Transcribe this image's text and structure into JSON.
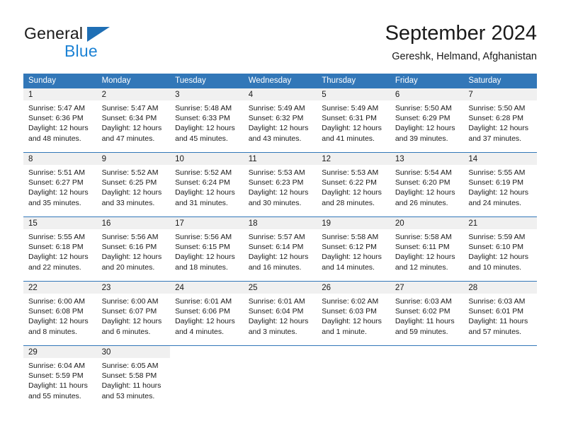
{
  "brand": {
    "name_part1": "General",
    "name_part2": "Blue",
    "triangle_color": "#1f6fb5",
    "blue_color": "#1c82d4"
  },
  "header": {
    "title": "September 2024",
    "location": "Gereshk, Helmand, Afghanistan"
  },
  "theme": {
    "header_row_bg": "#3277b8",
    "daynum_band_bg": "#f0f0f0",
    "grid_line": "#3277b8",
    "text": "#1a1a1a"
  },
  "weekday_headers": [
    "Sunday",
    "Monday",
    "Tuesday",
    "Wednesday",
    "Thursday",
    "Friday",
    "Saturday"
  ],
  "weeks": [
    [
      {
        "day": "1",
        "sunrise": "Sunrise: 5:47 AM",
        "sunset": "Sunset: 6:36 PM",
        "daylight": "Daylight: 12 hours and 48 minutes."
      },
      {
        "day": "2",
        "sunrise": "Sunrise: 5:47 AM",
        "sunset": "Sunset: 6:34 PM",
        "daylight": "Daylight: 12 hours and 47 minutes."
      },
      {
        "day": "3",
        "sunrise": "Sunrise: 5:48 AM",
        "sunset": "Sunset: 6:33 PM",
        "daylight": "Daylight: 12 hours and 45 minutes."
      },
      {
        "day": "4",
        "sunrise": "Sunrise: 5:49 AM",
        "sunset": "Sunset: 6:32 PM",
        "daylight": "Daylight: 12 hours and 43 minutes."
      },
      {
        "day": "5",
        "sunrise": "Sunrise: 5:49 AM",
        "sunset": "Sunset: 6:31 PM",
        "daylight": "Daylight: 12 hours and 41 minutes."
      },
      {
        "day": "6",
        "sunrise": "Sunrise: 5:50 AM",
        "sunset": "Sunset: 6:29 PM",
        "daylight": "Daylight: 12 hours and 39 minutes."
      },
      {
        "day": "7",
        "sunrise": "Sunrise: 5:50 AM",
        "sunset": "Sunset: 6:28 PM",
        "daylight": "Daylight: 12 hours and 37 minutes."
      }
    ],
    [
      {
        "day": "8",
        "sunrise": "Sunrise: 5:51 AM",
        "sunset": "Sunset: 6:27 PM",
        "daylight": "Daylight: 12 hours and 35 minutes."
      },
      {
        "day": "9",
        "sunrise": "Sunrise: 5:52 AM",
        "sunset": "Sunset: 6:25 PM",
        "daylight": "Daylight: 12 hours and 33 minutes."
      },
      {
        "day": "10",
        "sunrise": "Sunrise: 5:52 AM",
        "sunset": "Sunset: 6:24 PM",
        "daylight": "Daylight: 12 hours and 31 minutes."
      },
      {
        "day": "11",
        "sunrise": "Sunrise: 5:53 AM",
        "sunset": "Sunset: 6:23 PM",
        "daylight": "Daylight: 12 hours and 30 minutes."
      },
      {
        "day": "12",
        "sunrise": "Sunrise: 5:53 AM",
        "sunset": "Sunset: 6:22 PM",
        "daylight": "Daylight: 12 hours and 28 minutes."
      },
      {
        "day": "13",
        "sunrise": "Sunrise: 5:54 AM",
        "sunset": "Sunset: 6:20 PM",
        "daylight": "Daylight: 12 hours and 26 minutes."
      },
      {
        "day": "14",
        "sunrise": "Sunrise: 5:55 AM",
        "sunset": "Sunset: 6:19 PM",
        "daylight": "Daylight: 12 hours and 24 minutes."
      }
    ],
    [
      {
        "day": "15",
        "sunrise": "Sunrise: 5:55 AM",
        "sunset": "Sunset: 6:18 PM",
        "daylight": "Daylight: 12 hours and 22 minutes."
      },
      {
        "day": "16",
        "sunrise": "Sunrise: 5:56 AM",
        "sunset": "Sunset: 6:16 PM",
        "daylight": "Daylight: 12 hours and 20 minutes."
      },
      {
        "day": "17",
        "sunrise": "Sunrise: 5:56 AM",
        "sunset": "Sunset: 6:15 PM",
        "daylight": "Daylight: 12 hours and 18 minutes."
      },
      {
        "day": "18",
        "sunrise": "Sunrise: 5:57 AM",
        "sunset": "Sunset: 6:14 PM",
        "daylight": "Daylight: 12 hours and 16 minutes."
      },
      {
        "day": "19",
        "sunrise": "Sunrise: 5:58 AM",
        "sunset": "Sunset: 6:12 PM",
        "daylight": "Daylight: 12 hours and 14 minutes."
      },
      {
        "day": "20",
        "sunrise": "Sunrise: 5:58 AM",
        "sunset": "Sunset: 6:11 PM",
        "daylight": "Daylight: 12 hours and 12 minutes."
      },
      {
        "day": "21",
        "sunrise": "Sunrise: 5:59 AM",
        "sunset": "Sunset: 6:10 PM",
        "daylight": "Daylight: 12 hours and 10 minutes."
      }
    ],
    [
      {
        "day": "22",
        "sunrise": "Sunrise: 6:00 AM",
        "sunset": "Sunset: 6:08 PM",
        "daylight": "Daylight: 12 hours and 8 minutes."
      },
      {
        "day": "23",
        "sunrise": "Sunrise: 6:00 AM",
        "sunset": "Sunset: 6:07 PM",
        "daylight": "Daylight: 12 hours and 6 minutes."
      },
      {
        "day": "24",
        "sunrise": "Sunrise: 6:01 AM",
        "sunset": "Sunset: 6:06 PM",
        "daylight": "Daylight: 12 hours and 4 minutes."
      },
      {
        "day": "25",
        "sunrise": "Sunrise: 6:01 AM",
        "sunset": "Sunset: 6:04 PM",
        "daylight": "Daylight: 12 hours and 3 minutes."
      },
      {
        "day": "26",
        "sunrise": "Sunrise: 6:02 AM",
        "sunset": "Sunset: 6:03 PM",
        "daylight": "Daylight: 12 hours and 1 minute."
      },
      {
        "day": "27",
        "sunrise": "Sunrise: 6:03 AM",
        "sunset": "Sunset: 6:02 PM",
        "daylight": "Daylight: 11 hours and 59 minutes."
      },
      {
        "day": "28",
        "sunrise": "Sunrise: 6:03 AM",
        "sunset": "Sunset: 6:01 PM",
        "daylight": "Daylight: 11 hours and 57 minutes."
      }
    ],
    [
      {
        "day": "29",
        "sunrise": "Sunrise: 6:04 AM",
        "sunset": "Sunset: 5:59 PM",
        "daylight": "Daylight: 11 hours and 55 minutes."
      },
      {
        "day": "30",
        "sunrise": "Sunrise: 6:05 AM",
        "sunset": "Sunset: 5:58 PM",
        "daylight": "Daylight: 11 hours and 53 minutes."
      },
      {
        "day": "",
        "sunrise": "",
        "sunset": "",
        "daylight": ""
      },
      {
        "day": "",
        "sunrise": "",
        "sunset": "",
        "daylight": ""
      },
      {
        "day": "",
        "sunrise": "",
        "sunset": "",
        "daylight": ""
      },
      {
        "day": "",
        "sunrise": "",
        "sunset": "",
        "daylight": ""
      },
      {
        "day": "",
        "sunrise": "",
        "sunset": "",
        "daylight": ""
      }
    ]
  ]
}
